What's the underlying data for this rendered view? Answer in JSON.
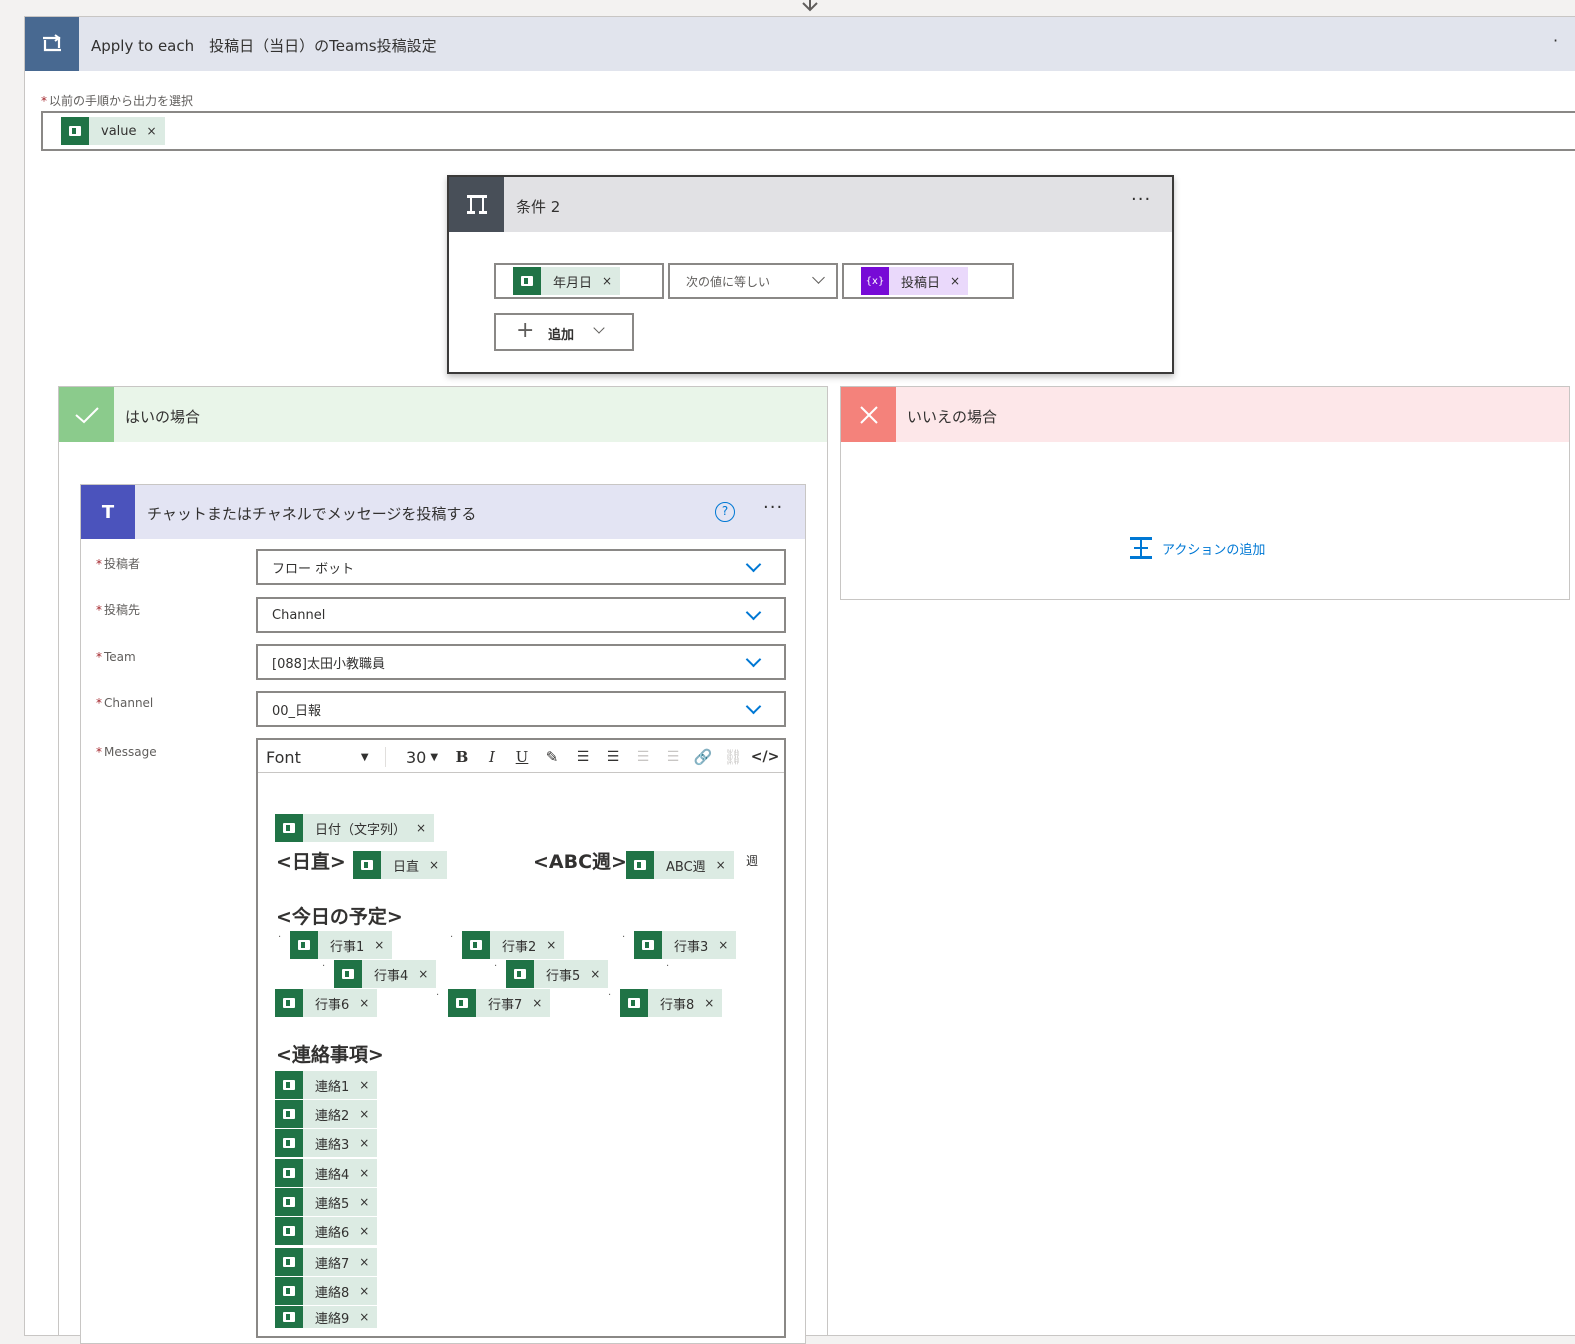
{
  "loop": {
    "title": "Apply to each　投稿日（当日）のTeams投稿設定",
    "select_label": "以前の手順から出力を選択",
    "token": "value"
  },
  "condition": {
    "title": "条件 2",
    "left_token": "年月日",
    "operator": "次の値に等しい",
    "right_token": "投稿日",
    "add_label": "追加"
  },
  "yes_branch": {
    "title": "はいの場合"
  },
  "no_branch": {
    "title": "いいえの場合",
    "add_action": "アクションの追加"
  },
  "action": {
    "title": "チャットまたはチャネルでメッセージを投稿する",
    "fields": [
      {
        "label": "投稿者",
        "value": "フロー ボット"
      },
      {
        "label": "投稿先",
        "value": "Channel"
      },
      {
        "label": "Team",
        "value": "[088]太田小教職員"
      },
      {
        "label": "Channel",
        "value": "00_日報"
      }
    ],
    "message_label": "Message",
    "toolbar": {
      "font": "Font",
      "size": "30",
      "bold": "B",
      "italic": "I",
      "underline": "U"
    },
    "message": {
      "date_token": "日付（文字列）",
      "duty_heading": "<日直>",
      "duty_token": "日直",
      "abc_heading": "<ABC週>",
      "abc_token": "ABC週",
      "abc_suffix": "週",
      "schedule_heading": "<今日の予定>",
      "events": [
        "行事1",
        "行事2",
        "行事3",
        "行事4",
        "行事5",
        "行事6",
        "行事7",
        "行事8"
      ],
      "notice_heading": "<連絡事項>",
      "notices": [
        "連絡1",
        "連絡2",
        "連絡3",
        "連絡4",
        "連絡5",
        "連絡6",
        "連絡7",
        "連絡8",
        "連絡9"
      ]
    }
  },
  "colors": {
    "loop_header": "#e1e4ed",
    "loop_icon": "#486991",
    "excel": "#207346",
    "yes": "#e9f5e9",
    "yes_icon": "#8bcb8c",
    "no": "#fde7e9",
    "no_icon": "#f4827b",
    "teams": "#e3e4f3",
    "teams_icon": "#4b53bc",
    "variable": "#770bd6"
  }
}
